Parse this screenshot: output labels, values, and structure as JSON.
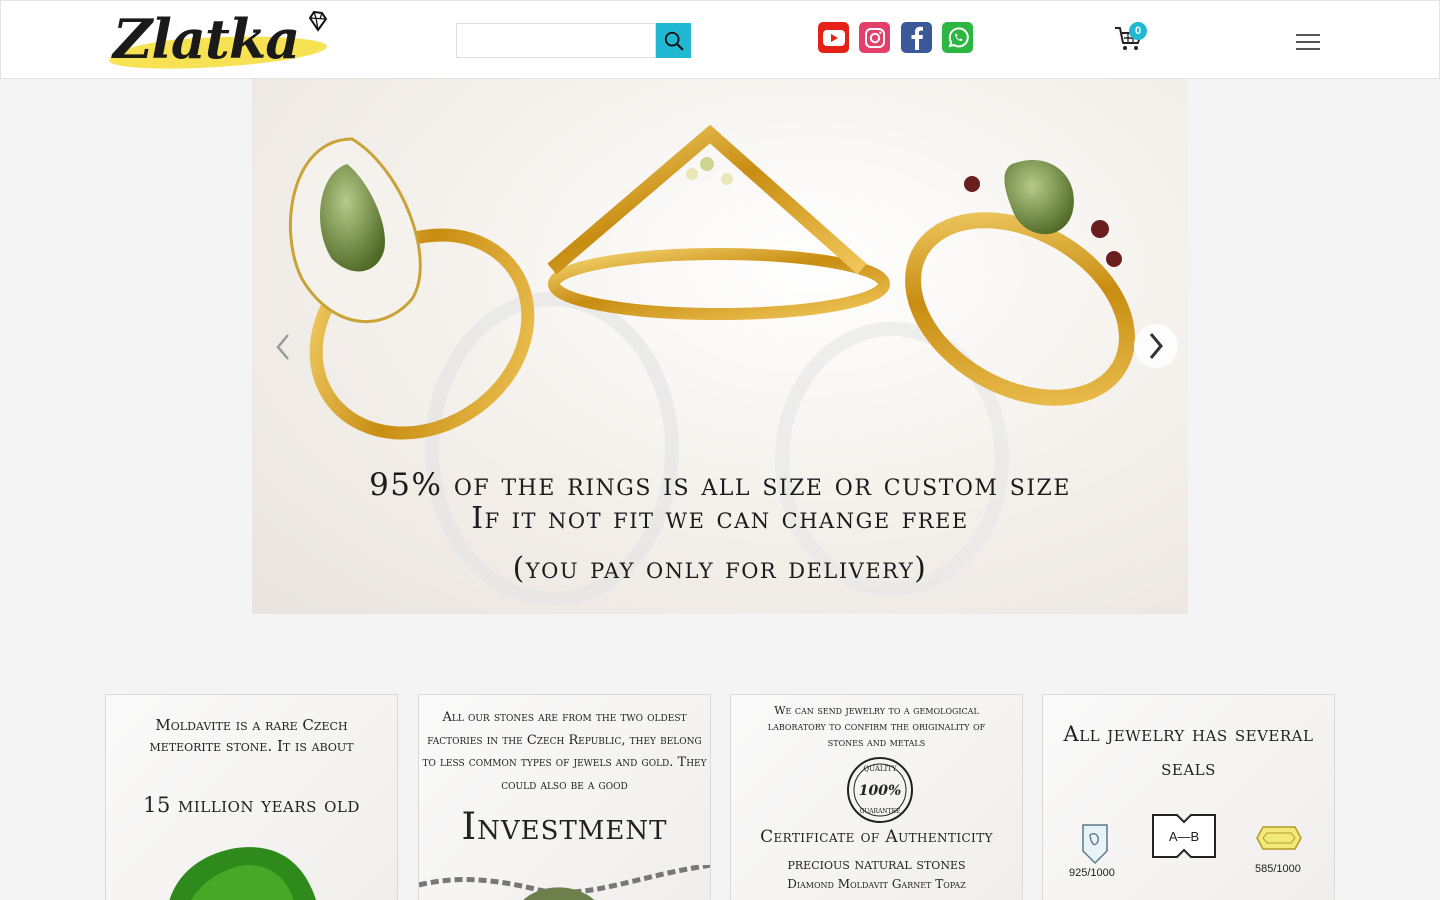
{
  "header": {
    "logo_text": "Zlatka",
    "search": {
      "placeholder": "",
      "value": ""
    },
    "social": {
      "youtube": "youtube-icon",
      "instagram": "instagram-icon",
      "facebook": "facebook-icon",
      "whatsapp": "whatsapp-icon"
    },
    "cart_count": "0"
  },
  "slider": {
    "headline": "95% of the rings is all size or custom size",
    "sub_line1": "If it not fit we can change free",
    "sub_line2": "(you pay only for delivery)"
  },
  "cards": [
    {
      "line1": "Moldavite is a rare Czech meteorite stone. It is about",
      "line2": "15 million years old"
    },
    {
      "line1": "All our stones are from the two oldest factories in the Czech Republic, they belong to less common types of jewels and gold. They could also be a good",
      "line2": "Investment"
    },
    {
      "line1": "We can send jewelry to a gemological laboratory to confirm the originality of stones and metals",
      "badge": "100%",
      "badge_top": "QUALITY",
      "badge_bottom": "GUARANTEE",
      "line2": "Certificate of Authenticity",
      "line3": "precious natural stones",
      "line4": "Diamond Moldavit Garnet Topaz"
    },
    {
      "line1": "All jewelry has several seals",
      "seal_mark": "A—B",
      "seal_silver": "925/1000",
      "seal_gold": "585/1000"
    }
  ],
  "colors": {
    "accent": "#21b8d3",
    "logo_yellow": "#f7e04a",
    "gold": "#d9a520"
  }
}
